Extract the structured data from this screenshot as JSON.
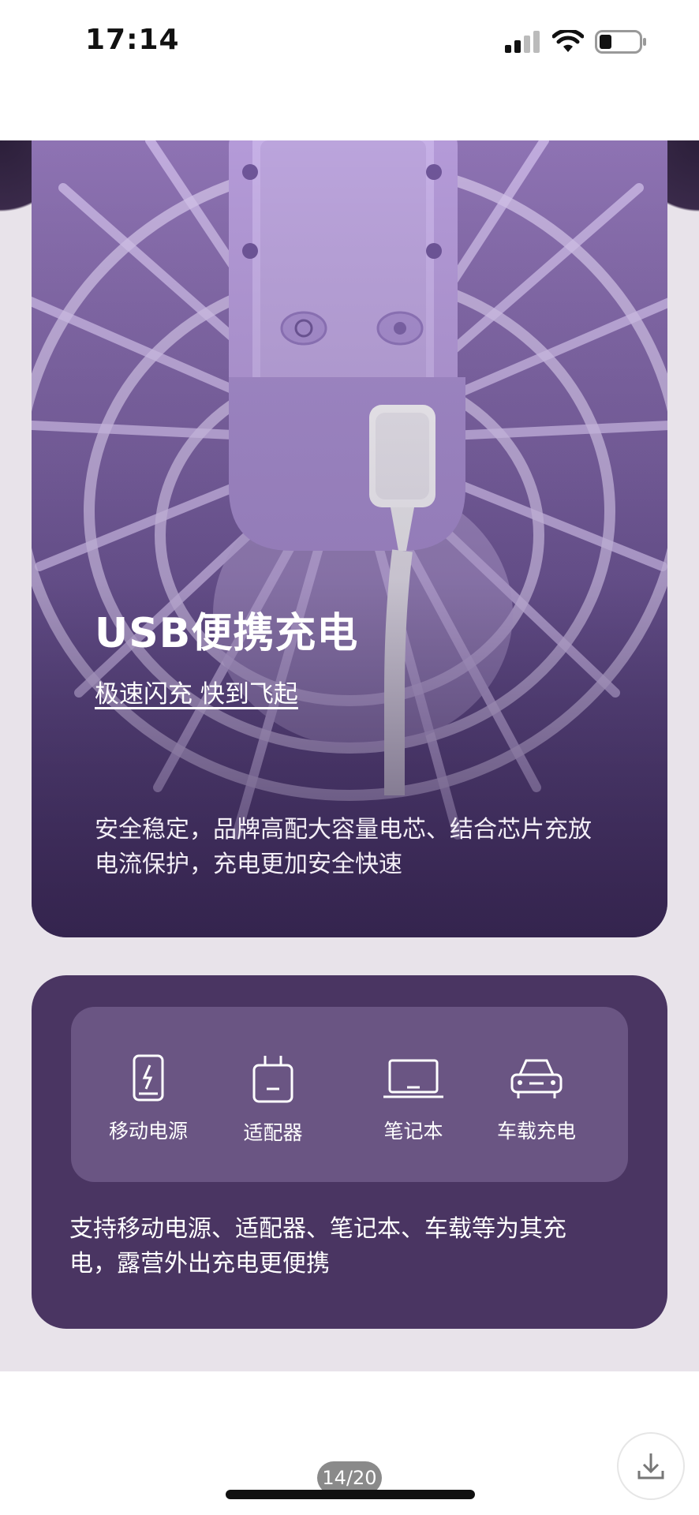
{
  "status": {
    "time": "17:14"
  },
  "feature": {
    "title": "USB便携充电",
    "subtitle": "极速闪充 快到飞起",
    "description": "安全稳定，品牌高配大容量电芯、结合芯片充放电流保护，充电更加安全快速"
  },
  "sources": {
    "items": [
      {
        "label": "移动电源",
        "icon": "power-bank-icon"
      },
      {
        "label": "适配器",
        "icon": "adapter-icon"
      },
      {
        "label": "笔记本",
        "icon": "laptop-icon"
      },
      {
        "label": "车载充电",
        "icon": "car-icon"
      }
    ],
    "description": "支持移动电源、适配器、笔记本、车载等为其充电，露营外出充电更便携"
  },
  "viewer": {
    "page_indicator": "14/20"
  }
}
